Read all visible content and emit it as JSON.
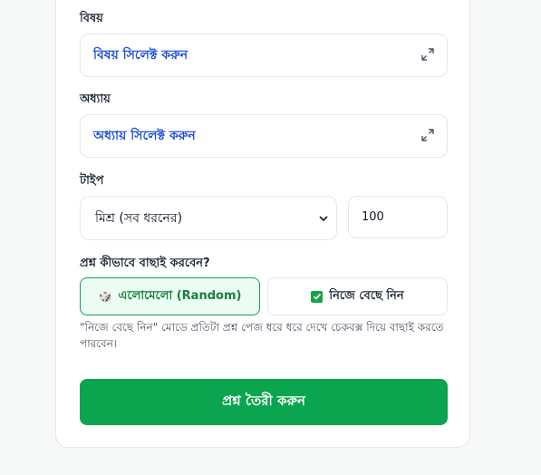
{
  "subject": {
    "label": "বিষয়",
    "placeholder": "বিষয় সিলেক্ট করুন",
    "expand_icon": "expand-icon"
  },
  "chapter": {
    "label": "অধ্যায়",
    "placeholder": "অধ্যায় সিলেক্ট করুন",
    "expand_icon": "expand-icon"
  },
  "type": {
    "label": "টাইপ",
    "selected": "মিশ্র (সব ধরনের)",
    "quantity": "100"
  },
  "selection_mode": {
    "question": "প্রশ্ন কীভাবে বাছাই করবেন?",
    "random_label": "এলোমেলো (Random)",
    "random_icon": "🎲",
    "manual_label": "নিজে বেছে নিন",
    "manual_checked": true,
    "hint": "\"নিজে বেছে নিন\" মোডে প্রতিটা প্রশ্ন পেজ ধরে ধরে দেখে চেকবক্স দিয়ে বাছাই করতে পারবেন।"
  },
  "create_button": {
    "label": "প্রশ্ন তৈরী করুন"
  },
  "colors": {
    "accent_green": "#0ba550",
    "link_blue": "#1d4ed8",
    "selected_bg": "#ecfdf3"
  }
}
